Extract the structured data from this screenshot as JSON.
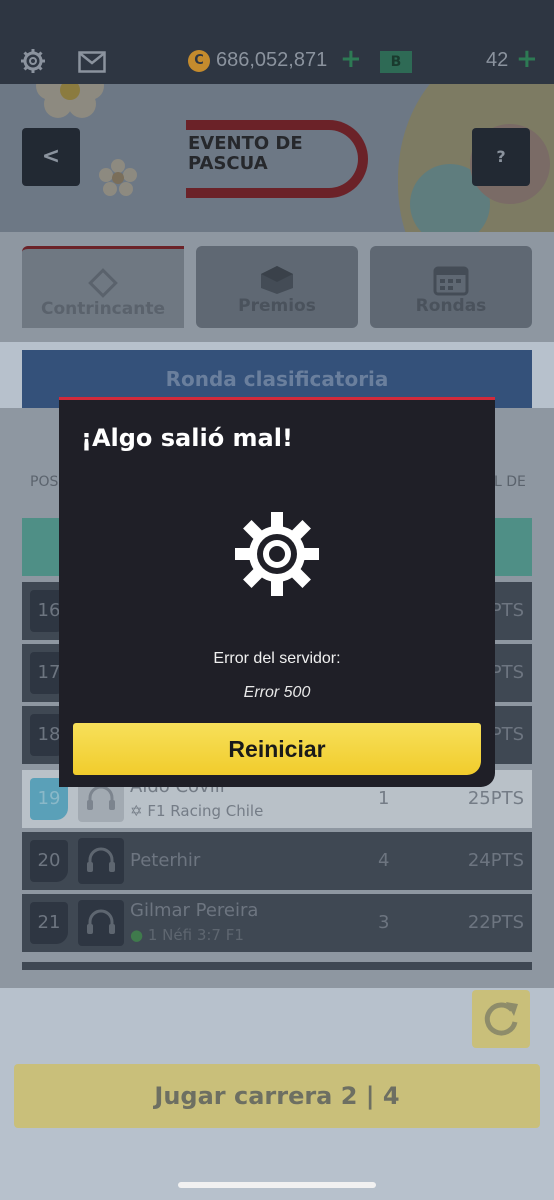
{
  "topbar": {
    "coin_symbol": "C",
    "coins": "686,052,871",
    "plus": "+",
    "badge": "B",
    "level": "42"
  },
  "hero": {
    "back_label": "<",
    "help_label": "?",
    "logo_line1": "EVENTO DE",
    "logo_line2": "PASCUA"
  },
  "tabs": [
    {
      "label": "Contrincante",
      "icon": "diamond-icon",
      "active": true
    },
    {
      "label": "Premios",
      "icon": "box-icon",
      "active": false
    },
    {
      "label": "Rondas",
      "icon": "calendar-icon",
      "active": false
    }
  ],
  "round_header": "Ronda clasificatoria",
  "columns": {
    "left": "POS",
    "right": "L DE"
  },
  "leaderboard": [
    {
      "pos": "16",
      "name": "",
      "team": "",
      "num": "",
      "pts": "PTS"
    },
    {
      "pos": "17",
      "name": "",
      "team": "",
      "num": "",
      "pts": "PTS"
    },
    {
      "pos": "18",
      "name": "",
      "team": "",
      "num": "",
      "pts": "PTS"
    },
    {
      "pos": "19",
      "name": "Aldo Covili",
      "team": "F1 Racing Chile",
      "num": "1",
      "pts": "25PTS",
      "me": true
    },
    {
      "pos": "20",
      "name": "Peterhir",
      "team": "",
      "num": "4",
      "pts": "24PTS"
    },
    {
      "pos": "21",
      "name": "Gilmar Pereira",
      "team": "1 Néfi 3:7 F1",
      "num": "3",
      "pts": "22PTS"
    }
  ],
  "play_button": "Jugar carrera 2 | 4",
  "modal": {
    "title": "¡Algo salió mal!",
    "message": "Error del servidor:",
    "code": "Error 500",
    "button": "Reiniciar"
  },
  "colors": {
    "accent_red": "#d22a3a",
    "button_yellow": "#f1cc2c",
    "modal_bg": "#1f1f27"
  }
}
